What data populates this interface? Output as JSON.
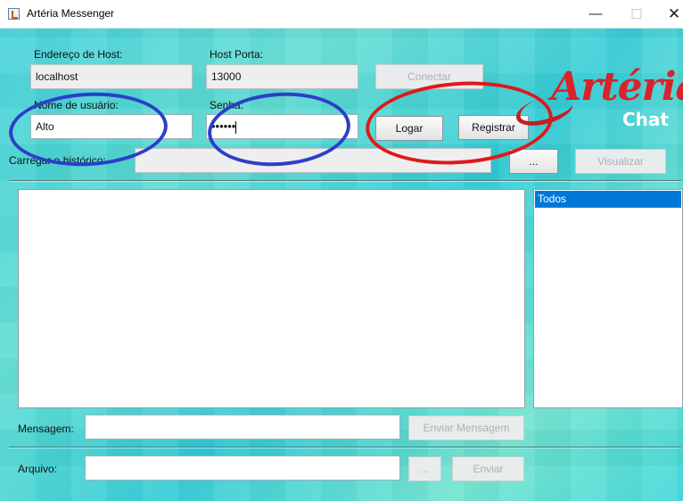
{
  "window": {
    "title": "Artéria Messenger",
    "minimize": "—",
    "maximize": "☐",
    "close": "✕"
  },
  "host": {
    "label": "Endereço de Host:",
    "value": "localhost"
  },
  "port": {
    "label": "Host Porta:",
    "value": "13000"
  },
  "connect_button": "Conectar",
  "username": {
    "label": "Nome de usuário:",
    "value": "Alto"
  },
  "password": {
    "label": "Senha:",
    "value": "••••••"
  },
  "login_button": "Logar",
  "register_button": "Registrar",
  "history": {
    "label": "Carregar o histórico:",
    "value": "",
    "browse_button": "...",
    "view_button": "Visualizar"
  },
  "logo": {
    "brand": "Artéria",
    "sub": "Chat"
  },
  "users_list": {
    "items": [
      "Todos"
    ]
  },
  "message": {
    "label": "Mensagem:",
    "value": "",
    "send_button": "Enviar Mensagem"
  },
  "file": {
    "label": "Arquivo:",
    "value": "",
    "browse_button": "...",
    "send_button": "Enviar"
  },
  "colors": {
    "accent": "#0078d7",
    "background": "#3fd7d8",
    "logo_red": "#d8232a",
    "annotation_blue": "#2d3ec8",
    "annotation_red": "#e01818"
  },
  "icons": {
    "app": "java-cup-icon"
  }
}
